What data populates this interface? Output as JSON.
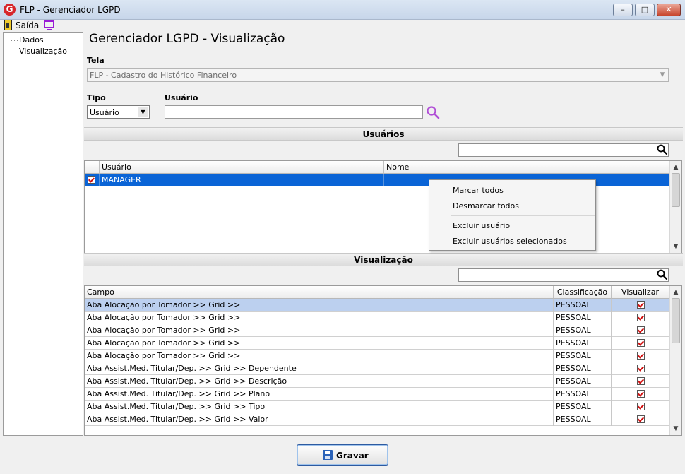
{
  "window": {
    "logo_letter": "G",
    "title": "FLP - Gerenciador LGPD",
    "minimize": "–",
    "maximize": "□",
    "close": "✕"
  },
  "menu": {
    "exit_label": "Saída"
  },
  "tree": {
    "items": [
      "Dados",
      "Visualização"
    ]
  },
  "page_title": "Gerenciador LGPD - Visualização",
  "tela": {
    "label": "Tela",
    "value": "FLP - Cadastro do Histórico Financeiro"
  },
  "tipo": {
    "label": "Tipo",
    "value": "Usuário"
  },
  "usuario": {
    "label": "Usuário",
    "value": ""
  },
  "users_section": {
    "title": "Usuários",
    "filter_value": "",
    "columns": [
      "Usuário",
      "Nome"
    ],
    "rows": [
      {
        "usuario": "MANAGER",
        "nome": "",
        "checked": true,
        "selected": true
      }
    ]
  },
  "context_menu": {
    "items": [
      "Marcar todos",
      "Desmarcar todos",
      "Excluir usuário",
      "Excluir usuários selecionados"
    ]
  },
  "view_section": {
    "title": "Visualização",
    "filter_value": "",
    "columns": [
      "Campo",
      "Classificação",
      "Visualizar"
    ],
    "rows": [
      {
        "campo": "Aba Alocação por Tomador >> Grid >>",
        "classificacao": "PESSOAL",
        "visualizar": true
      },
      {
        "campo": "Aba Alocação por Tomador >> Grid >>",
        "classificacao": "PESSOAL",
        "visualizar": true
      },
      {
        "campo": "Aba Alocação por Tomador >> Grid >>",
        "classificacao": "PESSOAL",
        "visualizar": true
      },
      {
        "campo": "Aba Alocação por Tomador >> Grid >>",
        "classificacao": "PESSOAL",
        "visualizar": true
      },
      {
        "campo": "Aba Alocação por Tomador >> Grid >>",
        "classificacao": "PESSOAL",
        "visualizar": true
      },
      {
        "campo": "Aba Assist.Med. Titular/Dep. >> Grid >> Dependente",
        "classificacao": "PESSOAL",
        "visualizar": true
      },
      {
        "campo": "Aba Assist.Med. Titular/Dep. >> Grid >> Descrição",
        "classificacao": "PESSOAL",
        "visualizar": true
      },
      {
        "campo": "Aba Assist.Med. Titular/Dep. >> Grid >> Plano",
        "classificacao": "PESSOAL",
        "visualizar": true
      },
      {
        "campo": "Aba Assist.Med. Titular/Dep. >> Grid >> Tipo",
        "classificacao": "PESSOAL",
        "visualizar": true
      },
      {
        "campo": "Aba Assist.Med. Titular/Dep. >> Grid >> Valor",
        "classificacao": "PESSOAL",
        "visualizar": true
      }
    ]
  },
  "save_button": {
    "label": "Gravar"
  },
  "colors": {
    "selection_blue": "#0a64d6",
    "highlight_row": "#bcd0ef",
    "check_red": "#d21010",
    "search_icon_purple": "#b04ed6"
  }
}
